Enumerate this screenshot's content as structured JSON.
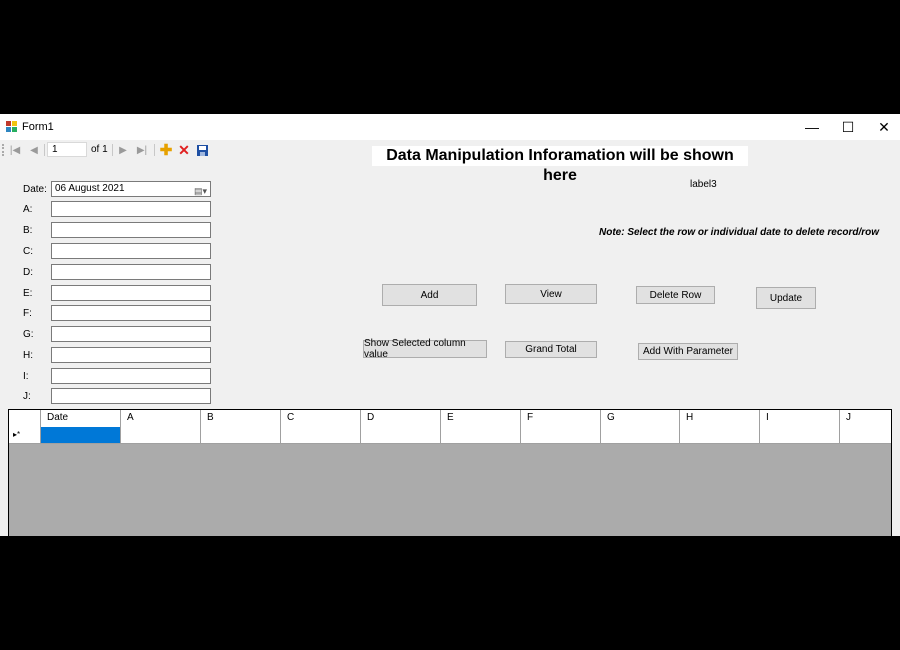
{
  "window": {
    "title": "Form1",
    "minimize": "—",
    "maximize": "☐",
    "close": "✕"
  },
  "navigator": {
    "position": "1",
    "count": "of 1"
  },
  "heading": "Data Manipulation Inforamation will be shown here",
  "label3": "label3",
  "note": "Note: Select the row or individual date to delete record/row",
  "form": {
    "date_label": "Date:",
    "date_value": "06   August   2021",
    "fields": [
      "A:",
      "B:",
      "C:",
      "D:",
      "E:",
      "F:",
      "G:",
      "H:",
      "I:",
      "J:"
    ]
  },
  "buttons": {
    "add": "Add",
    "view": "View",
    "delete_row": "Delete Row",
    "update": "Update",
    "show_selected": "Show Selected column value",
    "grand_total": "Grand Total",
    "add_with_parameter": "Add With Parameter"
  },
  "grid": {
    "columns": [
      "Date",
      "A",
      "B",
      "C",
      "D",
      "E",
      "F",
      "G",
      "H",
      "I",
      "J"
    ],
    "new_row_marker": "▸*",
    "selected_color": "#0078d7"
  }
}
